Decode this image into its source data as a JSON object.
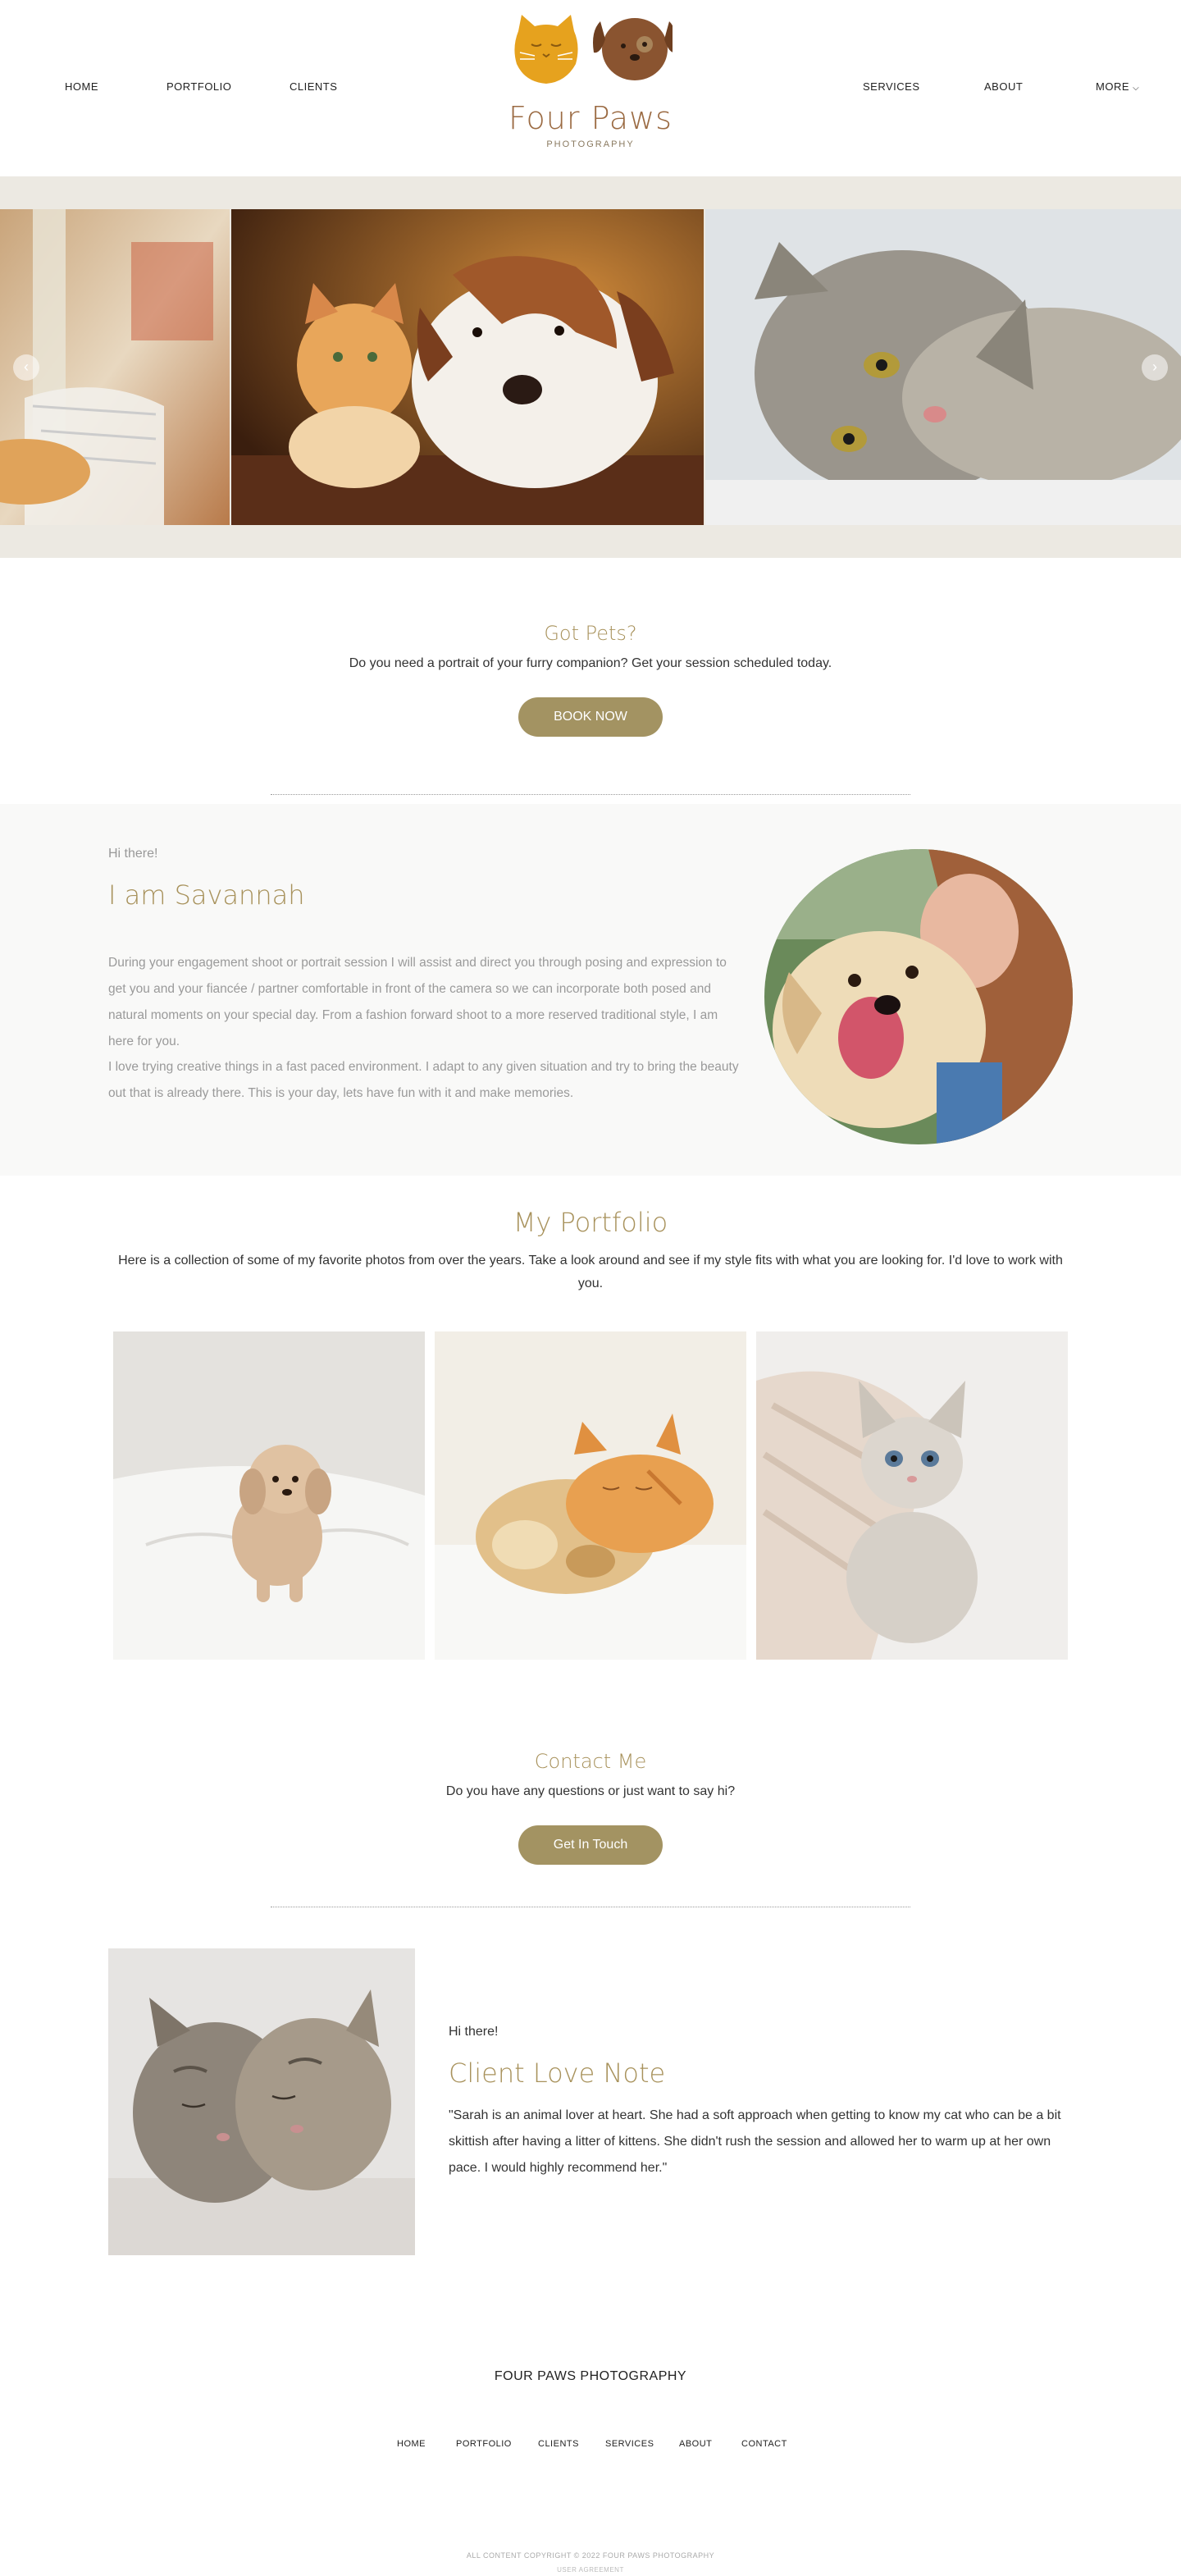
{
  "header": {
    "nav_left": [
      "HOME",
      "PORTFOLIO",
      "CLIENTS"
    ],
    "nav_right": [
      "SERVICES",
      "ABOUT",
      "MORE"
    ],
    "logo_title": "Four Paws",
    "logo_subtitle": "PHOTOGRAPHY"
  },
  "carousel": {
    "prev_icon": "chevron-left-icon",
    "next_icon": "chevron-right-icon"
  },
  "got_pets": {
    "title": "Got Pets?",
    "subtitle": "Do you need a portrait of your furry companion? Get your session scheduled today.",
    "button": "BOOK NOW"
  },
  "about": {
    "greeting": "Hi there!",
    "name": "I am Savannah",
    "paragraph1": "During your engagement shoot or portrait session I will assist and direct you through posing and expression to get you and your fiancée / partner comfortable in front of the camera so we can incorporate both posed and natural moments on your special day. From a fashion forward shoot to a more reserved traditional style, I am here for you.",
    "paragraph2": "I love trying creative things in a fast paced environment. I adapt to any given situation and try to bring the beauty out that is already there. This is your day, lets have fun with it and make memories."
  },
  "portfolio": {
    "title": "My Portfolio",
    "description": "Here is a collection of some of my favorite photos from over the years. Take a look around and see if my style fits with what you are looking for. I'd love to work with you."
  },
  "contact": {
    "title": "Contact Me",
    "subtitle": "Do you have any questions or just want to say hi?",
    "button": "Get In Touch"
  },
  "love_note": {
    "greeting": "Hi there!",
    "title": "Client Love Note",
    "quote": "\"Sarah is an animal lover at heart.  She had a soft approach when getting to know my cat who can be a bit skittish after having a litter of kittens.  She didn't rush the session and allowed her to warm up at her own pace.  I would highly recommend her.\""
  },
  "footer": {
    "brand": "FOUR PAWS PHOTOGRAPHY",
    "nav": [
      "HOME",
      "PORTFOLIO",
      "CLIENTS",
      "SERVICES",
      "ABOUT",
      "CONTACT"
    ],
    "copyright": "ALL CONTENT COPYRIGHT © 2022 FOUR PAWS PHOTOGRAPHY",
    "user_agreement": "USER AGREEMENT"
  },
  "colors": {
    "accent": "#a39362",
    "title": "#a8925c",
    "carousel_bg": "#ece9e2",
    "about_bg": "#f9f9f8"
  }
}
